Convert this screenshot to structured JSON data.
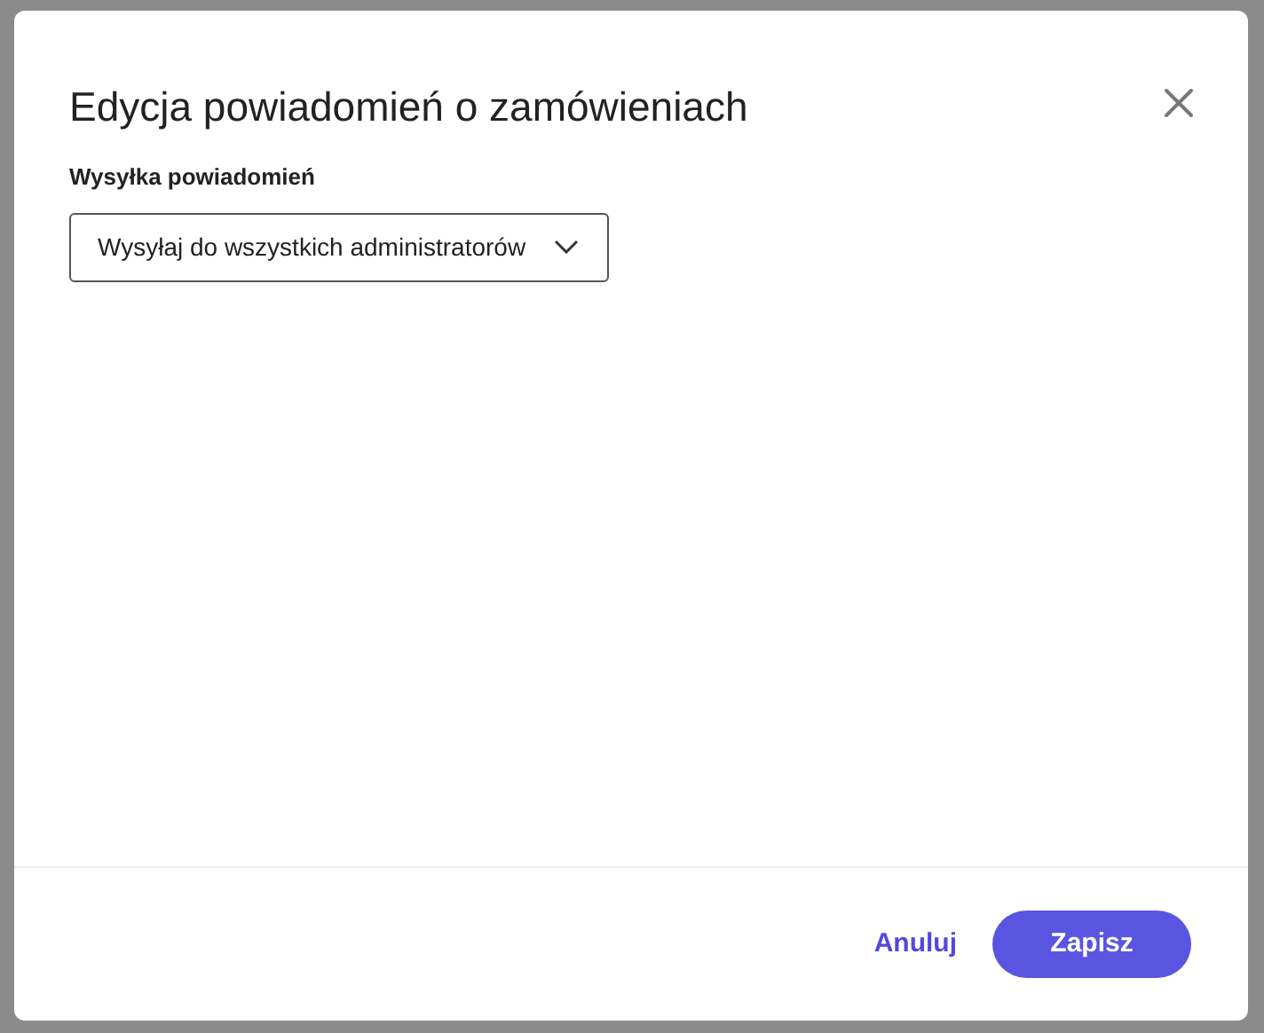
{
  "dialog": {
    "title": "Edycja powiadomień o zamówieniach",
    "fields": [
      {
        "kind": "select",
        "label": "Wysyłka powiadomień",
        "value": "Wysyłaj do wszystkich administratorów"
      }
    ],
    "buttons": [
      {
        "kind": "text",
        "label": "Anuluj"
      },
      {
        "kind": "primary",
        "label": "Zapisz"
      }
    ]
  }
}
